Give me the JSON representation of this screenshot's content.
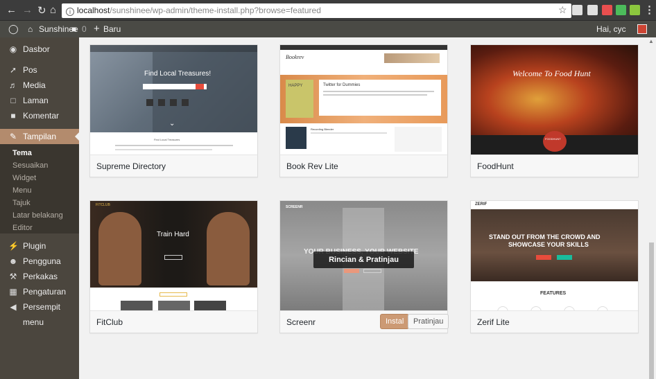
{
  "browser": {
    "url_host": "localhost",
    "url_path": "/sunshinee/wp-admin/theme-install.php?browse=featured",
    "info_glyph": "i",
    "ext_colors": [
      "#e0e0e0",
      "#e0e0e0",
      "#e94f4f",
      "#4cbb5b",
      "#8cc63e"
    ]
  },
  "adminbar": {
    "site_name": "Sunshinee",
    "comments_count": "0",
    "new_label": "Baru",
    "greeting": "Hai, cyc"
  },
  "sidebar": {
    "items": [
      {
        "label": "Dasbor",
        "icon": "dashboard-icon"
      },
      {
        "label": "Pos",
        "icon": "pin-icon"
      },
      {
        "label": "Media",
        "icon": "media-icon"
      },
      {
        "label": "Laman",
        "icon": "page-icon"
      },
      {
        "label": "Komentar",
        "icon": "comment-icon"
      },
      {
        "label": "Tampilan",
        "icon": "brush-icon"
      },
      {
        "label": "Plugin",
        "icon": "plugin-icon"
      },
      {
        "label": "Pengguna",
        "icon": "user-icon"
      },
      {
        "label": "Perkakas",
        "icon": "wrench-icon"
      },
      {
        "label": "Pengaturan",
        "icon": "settings-icon"
      },
      {
        "label": "Persempit menu",
        "icon": "collapse-icon"
      }
    ],
    "submenu": [
      "Tema",
      "Sesuaikan",
      "Widget",
      "Menu",
      "Tajuk",
      "Latar belakang",
      "Editor"
    ]
  },
  "themes": [
    {
      "name": "Supreme Directory",
      "preview_title": "Find Local Treasures!",
      "preview_sub": "Find Local Treasures"
    },
    {
      "name": "Book Rev Lite",
      "preview_title": "Twitter for Dummies",
      "preview_brand": "Bookrev",
      "preview_cover": "HAPPY",
      "preview_section": "Recording Blender"
    },
    {
      "name": "FoodHunt",
      "preview_title": "Welcome To Food Hunt",
      "preview_brand": "FOODHUNT"
    },
    {
      "name": "FitClub",
      "preview_title": "Train Hard",
      "preview_brand": "FITCLUB"
    },
    {
      "name": "Screenr",
      "preview_brand": "SCREENR",
      "preview_title": "YOUR BUSINESS, YOUR WEBSITE",
      "overlay": "Rincian & Pratinjau",
      "install": "Instal",
      "preview": "Pratinjau"
    },
    {
      "name": "Zerif Lite",
      "preview_brand": "ZERIF",
      "preview_title_1": "STAND OUT FROM THE CROWD AND",
      "preview_title_2": "SHOWCASE YOUR SKILLS",
      "preview_section": "FEATURES"
    }
  ]
}
